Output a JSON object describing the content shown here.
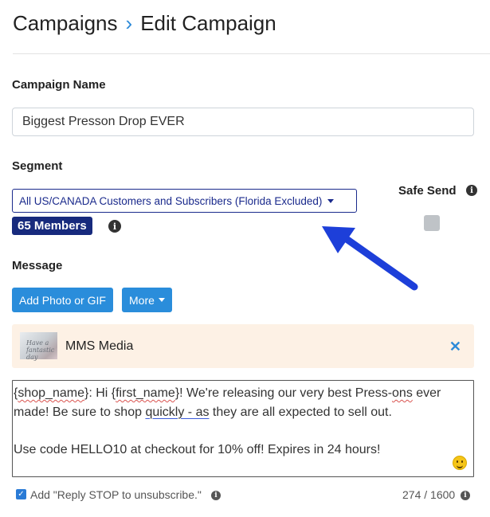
{
  "header": {
    "parent": "Campaigns",
    "current": "Edit Campaign"
  },
  "campaign_name": {
    "label": "Campaign Name",
    "value": "Biggest Presson Drop EVER"
  },
  "segment": {
    "label": "Segment",
    "selected": "All US/CANADA Customers and Subscribers (Florida Excluded)",
    "members": "65 Members"
  },
  "safe_send": {
    "label": "Safe Send",
    "enabled": false
  },
  "message": {
    "label": "Message",
    "add_photo_button": "Add Photo or GIF",
    "more_button": "More",
    "media": {
      "label": "MMS Media",
      "thumbnail_text": "Have a fantastic day"
    },
    "body": {
      "p1_a": "{",
      "p1_shop": "shop_name",
      "p1_b": "}: Hi {",
      "p1_first": "first_name",
      "p1_c": "}! We're releasing our very best Press-",
      "p1_ons": "ons",
      "p1_d": " ever made! Be sure to shop ",
      "p1_quickly": "quickly - as",
      "p1_e": " they are all expected to sell out.",
      "p2": "Use code HELLO10 at checkout for 10% off! Expires in 24 hours!"
    }
  },
  "footer": {
    "unsubscribe_label": "Add \"Reply STOP to unsubscribe.\"",
    "unsubscribe_checked": true,
    "char_count": "274 / 1600"
  },
  "colors": {
    "accent": "#2a8ddb",
    "navy": "#172a7d",
    "arrow": "#1d3fd9",
    "media_bg": "#fdf1e5"
  },
  "icons": [
    "chevron-right-icon",
    "info-icon",
    "caret-down-icon",
    "close-icon",
    "smiley-icon",
    "checkbox-checked-icon",
    "arrow-annotation"
  ]
}
